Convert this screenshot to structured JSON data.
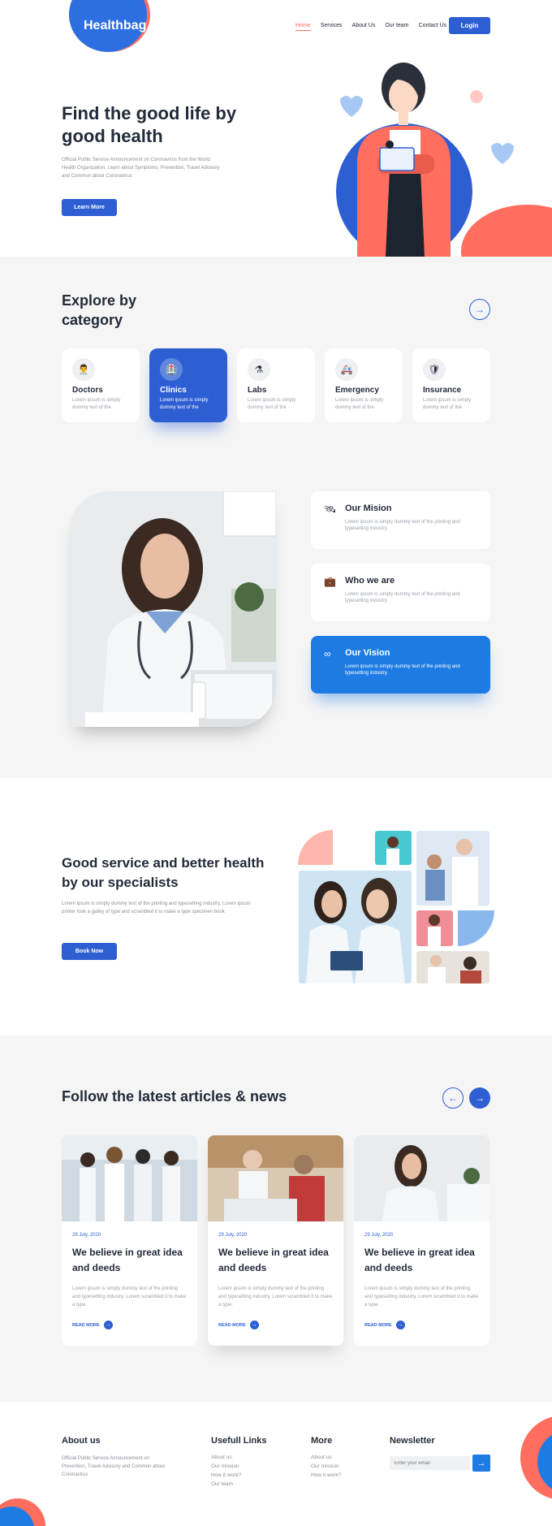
{
  "header": {
    "logo": "Healthbag",
    "nav": [
      "Home",
      "Services",
      "About Us",
      "Our team",
      "Contact Us"
    ],
    "login_label": "Login"
  },
  "hero": {
    "title": "Find the good life by good health",
    "description": "Official Public Service Announcement on Coronavirus from the World Health Organization. Learn about Symptoms, Prevention, Travel Advisory and Common about Coronavirus",
    "cta_label": "Learn More"
  },
  "category": {
    "title": "Explore by category",
    "next_icon": "arrow-right-icon",
    "items": [
      {
        "name": "Doctors",
        "desc": "Lorem ipsum is simply dummy text of the",
        "icon": "doctor-icon"
      },
      {
        "name": "Clinics",
        "desc": "Lorem ipsum is simply dummy text of the",
        "icon": "hospital-icon"
      },
      {
        "name": "Labs",
        "desc": "Lorem ipsum is simply dummy text of the",
        "icon": "flask-icon"
      },
      {
        "name": "Emergency",
        "desc": "Lorem ipsum is simply dummy text of the",
        "icon": "ambulance-icon"
      },
      {
        "name": "Insurance",
        "desc": "Lorem ipsum is simply dummy text of the",
        "icon": "shield-icon"
      }
    ]
  },
  "mission": {
    "cards": [
      {
        "title": "Our Mision",
        "desc": "Lorem ipsum is simply dummy text of the printing and typesetting industry.",
        "icon": "satellite-icon"
      },
      {
        "title": "Who we are",
        "desc": "Lorem ipsum is simply dummy text of the printing and typesetting industry.",
        "icon": "briefcase-icon"
      },
      {
        "title": "Our Vision",
        "desc": "Lorem ipsum is simply dummy text of the printing and typesetting industry.",
        "icon": "binoculars-icon"
      }
    ]
  },
  "service": {
    "title": "Good service and better health by our specialists",
    "description": "Lorem ipsum is simply dummy text of the printing and typesetting industry. Lorem ipsum printer took a galley of type and scrambled it to make a type specimen book",
    "cta_label": "Book Now"
  },
  "news": {
    "title": "Follow the latest articles & news",
    "cards": [
      {
        "date": "29 July, 2020",
        "headline": "We believe in great idea and deeds",
        "desc": "Lorem ipsum is simply dummy text of the printing and typesetting industry. Lorem scrambled it to make a type.",
        "read_more": "READ MORE"
      },
      {
        "date": "29 July, 2020",
        "headline": "We believe in great idea and deeds",
        "desc": "Lorem ipsum is simply dummy text of the printing and typesetting industry. Lorem scrambled it to make a type.",
        "read_more": "READ MORE"
      },
      {
        "date": "29 July, 2020",
        "headline": "We believe in great idea and deeds",
        "desc": "Lorem ipsum is simply dummy text of the printing and typesetting industry. Lorem scrambled it to make a type.",
        "read_more": "READ MORE"
      }
    ]
  },
  "footer": {
    "about_title": "About us",
    "about_text": "Official Public Service Announcement on Prevention, Travel Advisory and Common about Coronavirus",
    "links_title": "Usefull Links",
    "links": [
      "About us",
      "Our mission",
      "How it work?",
      "Our team"
    ],
    "more_title": "More",
    "more_links": [
      "About us",
      "Our mission",
      "How it work?"
    ],
    "newsletter_title": "Newsletter",
    "newsletter_placeholder": "Enter your email"
  },
  "colors": {
    "primary": "#2d5fd3",
    "accent": "#ff6e5e",
    "vision": "#1e7be3"
  }
}
